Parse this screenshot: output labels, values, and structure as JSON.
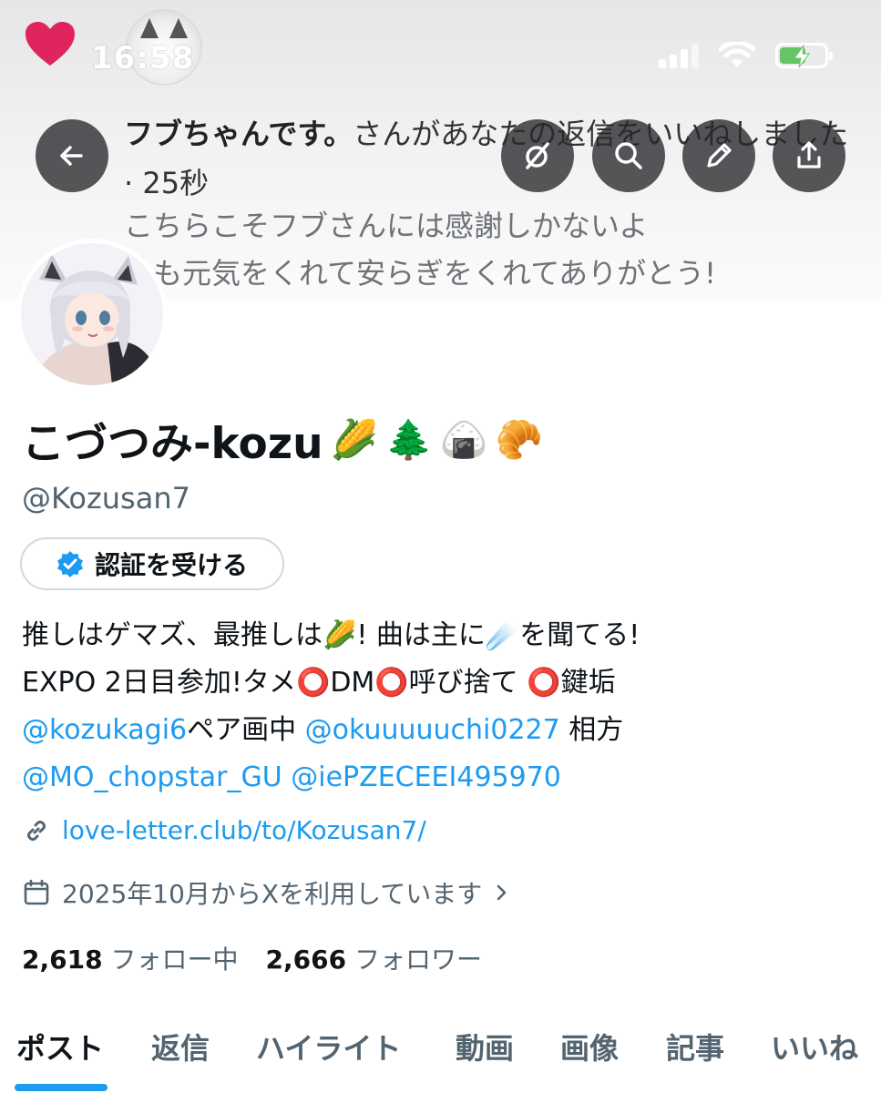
{
  "status_bar": {
    "time": "16:58"
  },
  "notification": {
    "actor": "フブちゃんです。",
    "action": "さんがあなたの返信をいいねしました",
    "time": "· 25秒",
    "reply_line1": "こちらこそフブさんには感謝しかないよ",
    "reply_line2": "つも元気をくれて安らぎをくれてありがとう!"
  },
  "header_actions": {
    "back": "back-arrow-icon",
    "grok": "grok-icon",
    "search": "search-icon",
    "edit": "pencil-icon",
    "share": "share-icon"
  },
  "profile": {
    "display_name": "こづつみ-kozu",
    "name_emojis": [
      "🌽",
      "🌲",
      "🍙",
      "🥐"
    ],
    "handle": "@Kozusan7",
    "verify_button": "認証を受ける",
    "bio": {
      "line1_a": "推しはゲマズ、最推しは",
      "line1_emoji1": "🌽",
      "line1_b": "! 曲は主に",
      "line1_emoji2": "☄️",
      "line1_c": "を聞てる!",
      "line2_a": "EXPO 2日目参加!タメ",
      "line2_b": "DM",
      "line2_c": "呼び捨て",
      "line2_d": "鍵垢",
      "circle": "⭕",
      "mention1": "@kozukagi6",
      "line3_mid": "ペア画中",
      "mention2": "@okuuuuuchi0227",
      "line3_end": "相方",
      "mention3": "@MO_chopstar_GU",
      "mention4": "@iePZECEEI495970"
    },
    "website": "love-letter.club/to/Kozusan7/",
    "joined": "2025年10月からXを利用しています",
    "following_count": "2,618",
    "following_label": "フォロー中",
    "followers_count": "2,666",
    "followers_label": "フォロワー"
  },
  "tabs": [
    "ポスト",
    "返信",
    "ハイライト",
    "動画",
    "画像",
    "記事",
    "いいね"
  ],
  "colors": {
    "accent": "#1d9bf0",
    "heart": "#e0245e",
    "text": "#0f1419",
    "muted": "#536471"
  }
}
